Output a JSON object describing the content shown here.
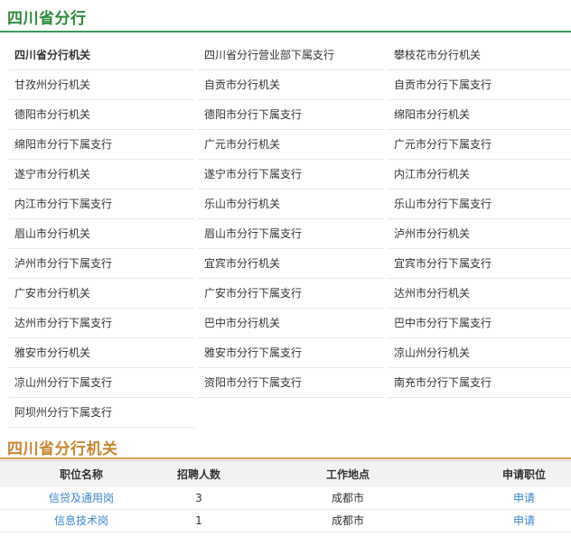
{
  "section1": {
    "title": "四川省分行"
  },
  "branches": [
    "四川省分行机关",
    "四川省分行营业部下属支行",
    "攀枝花市分行机关",
    "甘孜州分行机关",
    "自贡市分行机关",
    "自贡市分行下属支行",
    "德阳市分行机关",
    "德阳市分行下属支行",
    "绵阳市分行机关",
    "绵阳市分行下属支行",
    "广元市分行机关",
    "广元市分行下属支行",
    "遂宁市分行机关",
    "遂宁市分行下属支行",
    "内江市分行机关",
    "内江市分行下属支行",
    "乐山市分行机关",
    "乐山市分行下属支行",
    "眉山市分行机关",
    "眉山市分行下属支行",
    "泸州市分行机关",
    "泸州市分行下属支行",
    "宜宾市分行机关",
    "宜宾市分行下属支行",
    "广安市分行机关",
    "广安市分行下属支行",
    "达州市分行机关",
    "达州市分行下属支行",
    "巴中市分行机关",
    "巴中市分行下属支行",
    "雅安市分行机关",
    "雅安市分行下属支行",
    "凉山州分行机关",
    "凉山州分行下属支行",
    "资阳市分行下属支行",
    "南充市分行下属支行",
    "阿坝州分行下属支行"
  ],
  "section2": {
    "title": "四川省分行机关"
  },
  "jobs": {
    "headers": [
      "职位名称",
      "招聘人数",
      "工作地点",
      "申请职位"
    ],
    "rows": [
      {
        "name": "信贷及通用岗",
        "count": "3",
        "location": "成都市",
        "apply": "申请"
      },
      {
        "name": "信息技术岗",
        "count": "1",
        "location": "成都市",
        "apply": "申请"
      }
    ]
  }
}
